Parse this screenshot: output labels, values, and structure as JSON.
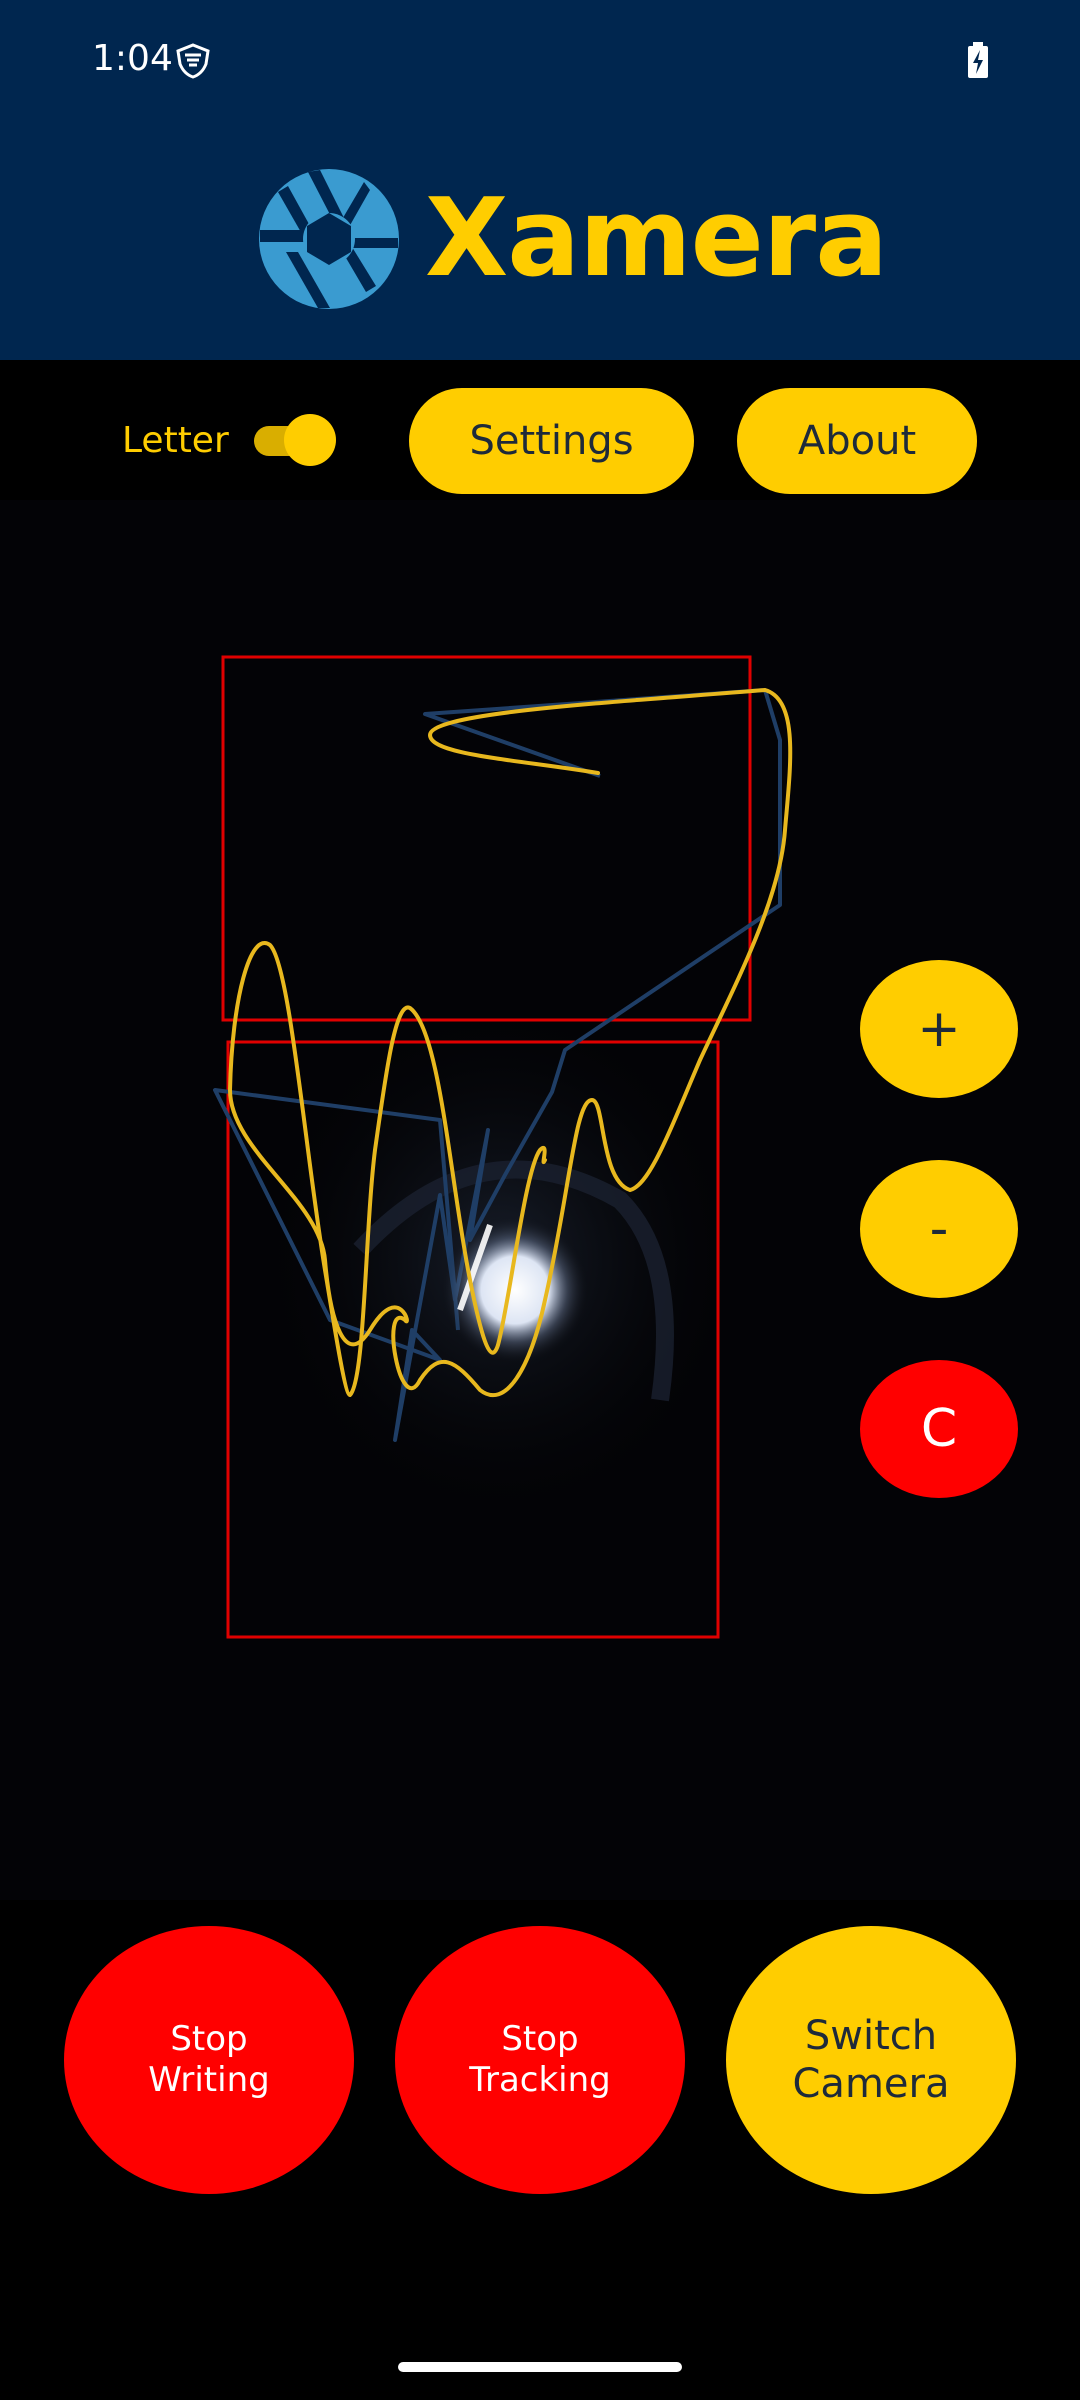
{
  "status_bar": {
    "time": "1:04",
    "icons": [
      "vpn-shield-icon",
      "battery-charging-icon"
    ]
  },
  "header": {
    "app_title": "Xamera",
    "logo_icon": "camera-aperture-icon",
    "background_color": "#00264f",
    "accent_color": "#ffcd00"
  },
  "toolbar": {
    "letter_label": "Letter",
    "letter_toggle_on": true,
    "settings_label": "Settings",
    "about_label": "About"
  },
  "side_controls": {
    "zoom_in_label": "+",
    "zoom_out_label": "-",
    "clear_label": "C"
  },
  "bottom_controls": {
    "stop_writing_label": "Stop\nWriting",
    "stop_tracking_label": "Stop\nTracking",
    "switch_camera_label": "Switch\nCamera"
  },
  "colors": {
    "primary_yellow": "#ffcd00",
    "danger_red": "#ff0000",
    "header_navy": "#00264f",
    "trace_blue": "#1f3e66",
    "box_red": "#e00000"
  }
}
